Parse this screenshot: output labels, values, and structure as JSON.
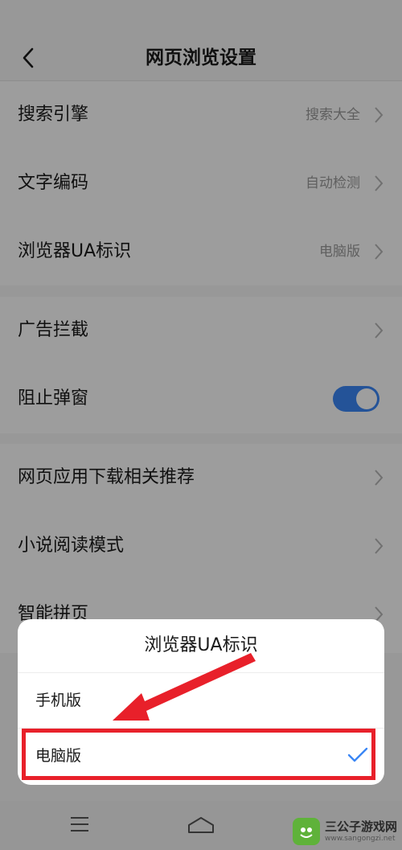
{
  "header": {
    "title": "网页浏览设置"
  },
  "settings": {
    "search_engine": {
      "label": "搜索引擎",
      "value": "搜索大全"
    },
    "text_encoding": {
      "label": "文字编码",
      "value": "自动检测"
    },
    "ua_identity": {
      "label": "浏览器UA标识",
      "value": "电脑版"
    },
    "ad_block": {
      "label": "广告拦截"
    },
    "block_popups": {
      "label": "阻止弹窗",
      "enabled": true
    },
    "app_download_recommend": {
      "label": "网页应用下载相关推荐"
    },
    "novel_reading_mode": {
      "label": "小说阅读模式"
    },
    "smart_paging": {
      "label": "智能拼页"
    }
  },
  "dialog": {
    "title": "浏览器UA标识",
    "options": [
      {
        "label": "手机版",
        "selected": false
      },
      {
        "label": "电脑版",
        "selected": true
      }
    ]
  },
  "watermark": {
    "name": "三公子游戏网",
    "url": "www.sangongzi.net"
  },
  "colors": {
    "accent": "#3a86f5",
    "highlight": "#e8202a"
  }
}
